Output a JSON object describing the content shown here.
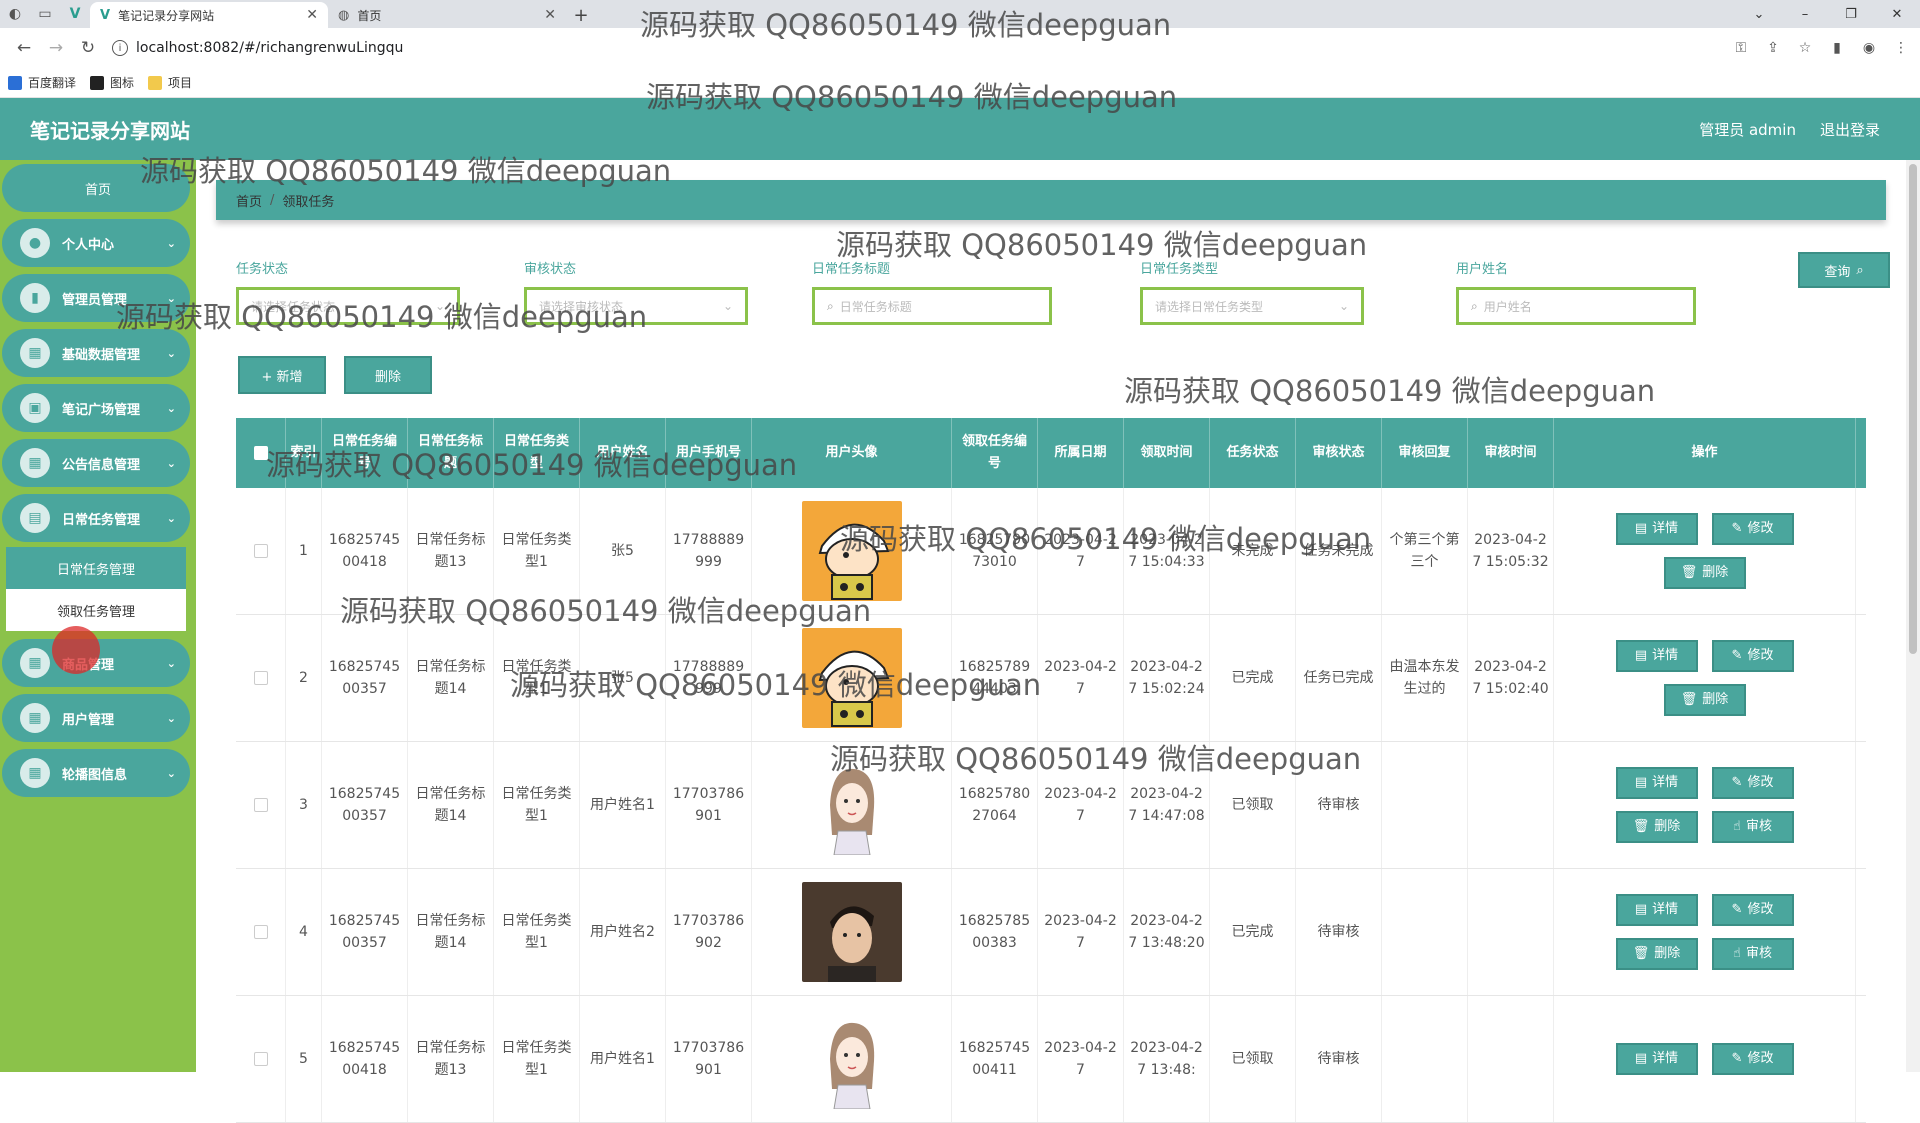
{
  "browser": {
    "tabs": [
      {
        "label": "笔记记录分享网站",
        "active": true
      },
      {
        "label": "首页",
        "active": false
      }
    ],
    "url": "localhost:8082/#/richangrenwuLingqu",
    "bookmarks": [
      "百度翻译",
      "图标",
      "项目"
    ]
  },
  "header": {
    "title": "笔记记录分享网站",
    "user": "管理员 admin",
    "logout": "退出登录"
  },
  "sidebar": {
    "home": "首页",
    "items": [
      {
        "label": "个人中心",
        "icon": "user-icon"
      },
      {
        "label": "管理员管理",
        "icon": "chart-icon"
      },
      {
        "label": "基础数据管理",
        "icon": "grid-icon"
      },
      {
        "label": "笔记广场管理",
        "icon": "briefcase-icon"
      },
      {
        "label": "公告信息管理",
        "icon": "grid-icon"
      },
      {
        "label": "日常任务管理",
        "icon": "clipboard-icon"
      }
    ],
    "submenu": [
      "日常任务管理",
      "领取任务管理"
    ],
    "items_after": [
      {
        "label": "商品管理",
        "icon": "grid-icon"
      },
      {
        "label": "用户管理",
        "icon": "grid-icon"
      },
      {
        "label": "轮播图信息",
        "icon": "grid-icon"
      }
    ]
  },
  "breadcrumb": {
    "home": "首页",
    "current": "领取任务"
  },
  "filters": [
    {
      "label": "任务状态",
      "placeholder": "请选择任务状态",
      "type": "select"
    },
    {
      "label": "审核状态",
      "placeholder": "请选择审核状态",
      "type": "select"
    },
    {
      "label": "日常任务标题",
      "placeholder": "日常任务标题",
      "type": "input"
    },
    {
      "label": "日常任务类型",
      "placeholder": "请选择日常任务类型",
      "type": "select"
    },
    {
      "label": "用户姓名",
      "placeholder": "用户姓名",
      "type": "input"
    }
  ],
  "query_button": "查询",
  "actions": {
    "add": "+ 新增",
    "delete": "删除"
  },
  "table": {
    "headers": [
      "索引",
      "日常任务编号",
      "日常任务标题",
      "日常任务类型",
      "用户姓名",
      "用户手机号",
      "用户头像",
      "领取任务编号",
      "所属日期",
      "领取时间",
      "任务状态",
      "审核状态",
      "审核回复",
      "审核时间",
      "操作"
    ],
    "rows": [
      {
        "index": "1",
        "task_no": "1682574500418",
        "title": "日常任务标题13",
        "type": "日常任务类型1",
        "user": "张5",
        "phone": "17788889999",
        "avatar": "cartoon",
        "claim_no": "1682579073010",
        "date": "2023-04-27",
        "claim_time": "2023-04-27 15:04:33",
        "status": "未完成",
        "audit": "任务未完成",
        "reply": "个第三个第三个",
        "audit_time": "2023-04-27 15:05:32",
        "ops": [
          "详情",
          "修改",
          "删除"
        ]
      },
      {
        "index": "2",
        "task_no": "1682574500357",
        "title": "日常任务标题14",
        "type": "日常任务类型1",
        "user": "张5",
        "phone": "17788889999",
        "avatar": "cartoon",
        "claim_no": "1682578944403",
        "date": "2023-04-27",
        "claim_time": "2023-04-27 15:02:24",
        "status": "已完成",
        "audit": "任务已完成",
        "reply": "由温本东发生过的",
        "audit_time": "2023-04-27 15:02:40",
        "ops": [
          "详情",
          "修改",
          "删除"
        ]
      },
      {
        "index": "3",
        "task_no": "1682574500357",
        "title": "日常任务标题14",
        "type": "日常任务类型1",
        "user": "用户姓名1",
        "phone": "17703786901",
        "avatar": "girl",
        "claim_no": "1682578027064",
        "date": "2023-04-27",
        "claim_time": "2023-04-27 14:47:08",
        "status": "已领取",
        "audit": "待审核",
        "reply": "",
        "audit_time": "",
        "ops": [
          "详情",
          "修改",
          "删除",
          "审核"
        ]
      },
      {
        "index": "4",
        "task_no": "1682574500357",
        "title": "日常任务标题14",
        "type": "日常任务类型1",
        "user": "用户姓名2",
        "phone": "17703786902",
        "avatar": "boy",
        "claim_no": "1682578500383",
        "date": "2023-04-27",
        "claim_time": "2023-04-27 13:48:20",
        "status": "已完成",
        "audit": "待审核",
        "reply": "",
        "audit_time": "",
        "ops": [
          "详情",
          "修改",
          "删除",
          "审核"
        ]
      },
      {
        "index": "5",
        "task_no": "1682574500418",
        "title": "日常任务标题13",
        "type": "日常任务类型1",
        "user": "用户姓名1",
        "phone": "17703786901",
        "avatar": "girl",
        "claim_no": "1682574500411",
        "date": "2023-04-27",
        "claim_time": "2023-04-27 13:48:",
        "status": "已领取",
        "audit": "待审核",
        "reply": "",
        "audit_time": "",
        "ops": [
          "详情",
          "修改"
        ]
      }
    ]
  },
  "op_icons": {
    "详情": "▤",
    "修改": "✎",
    "删除": "🗑",
    "审核": "☝"
  },
  "watermark": "源码获取 QQ86050149 微信deepguan",
  "colors": {
    "primary": "#4aa69d",
    "sidebar": "#8bc24a"
  }
}
